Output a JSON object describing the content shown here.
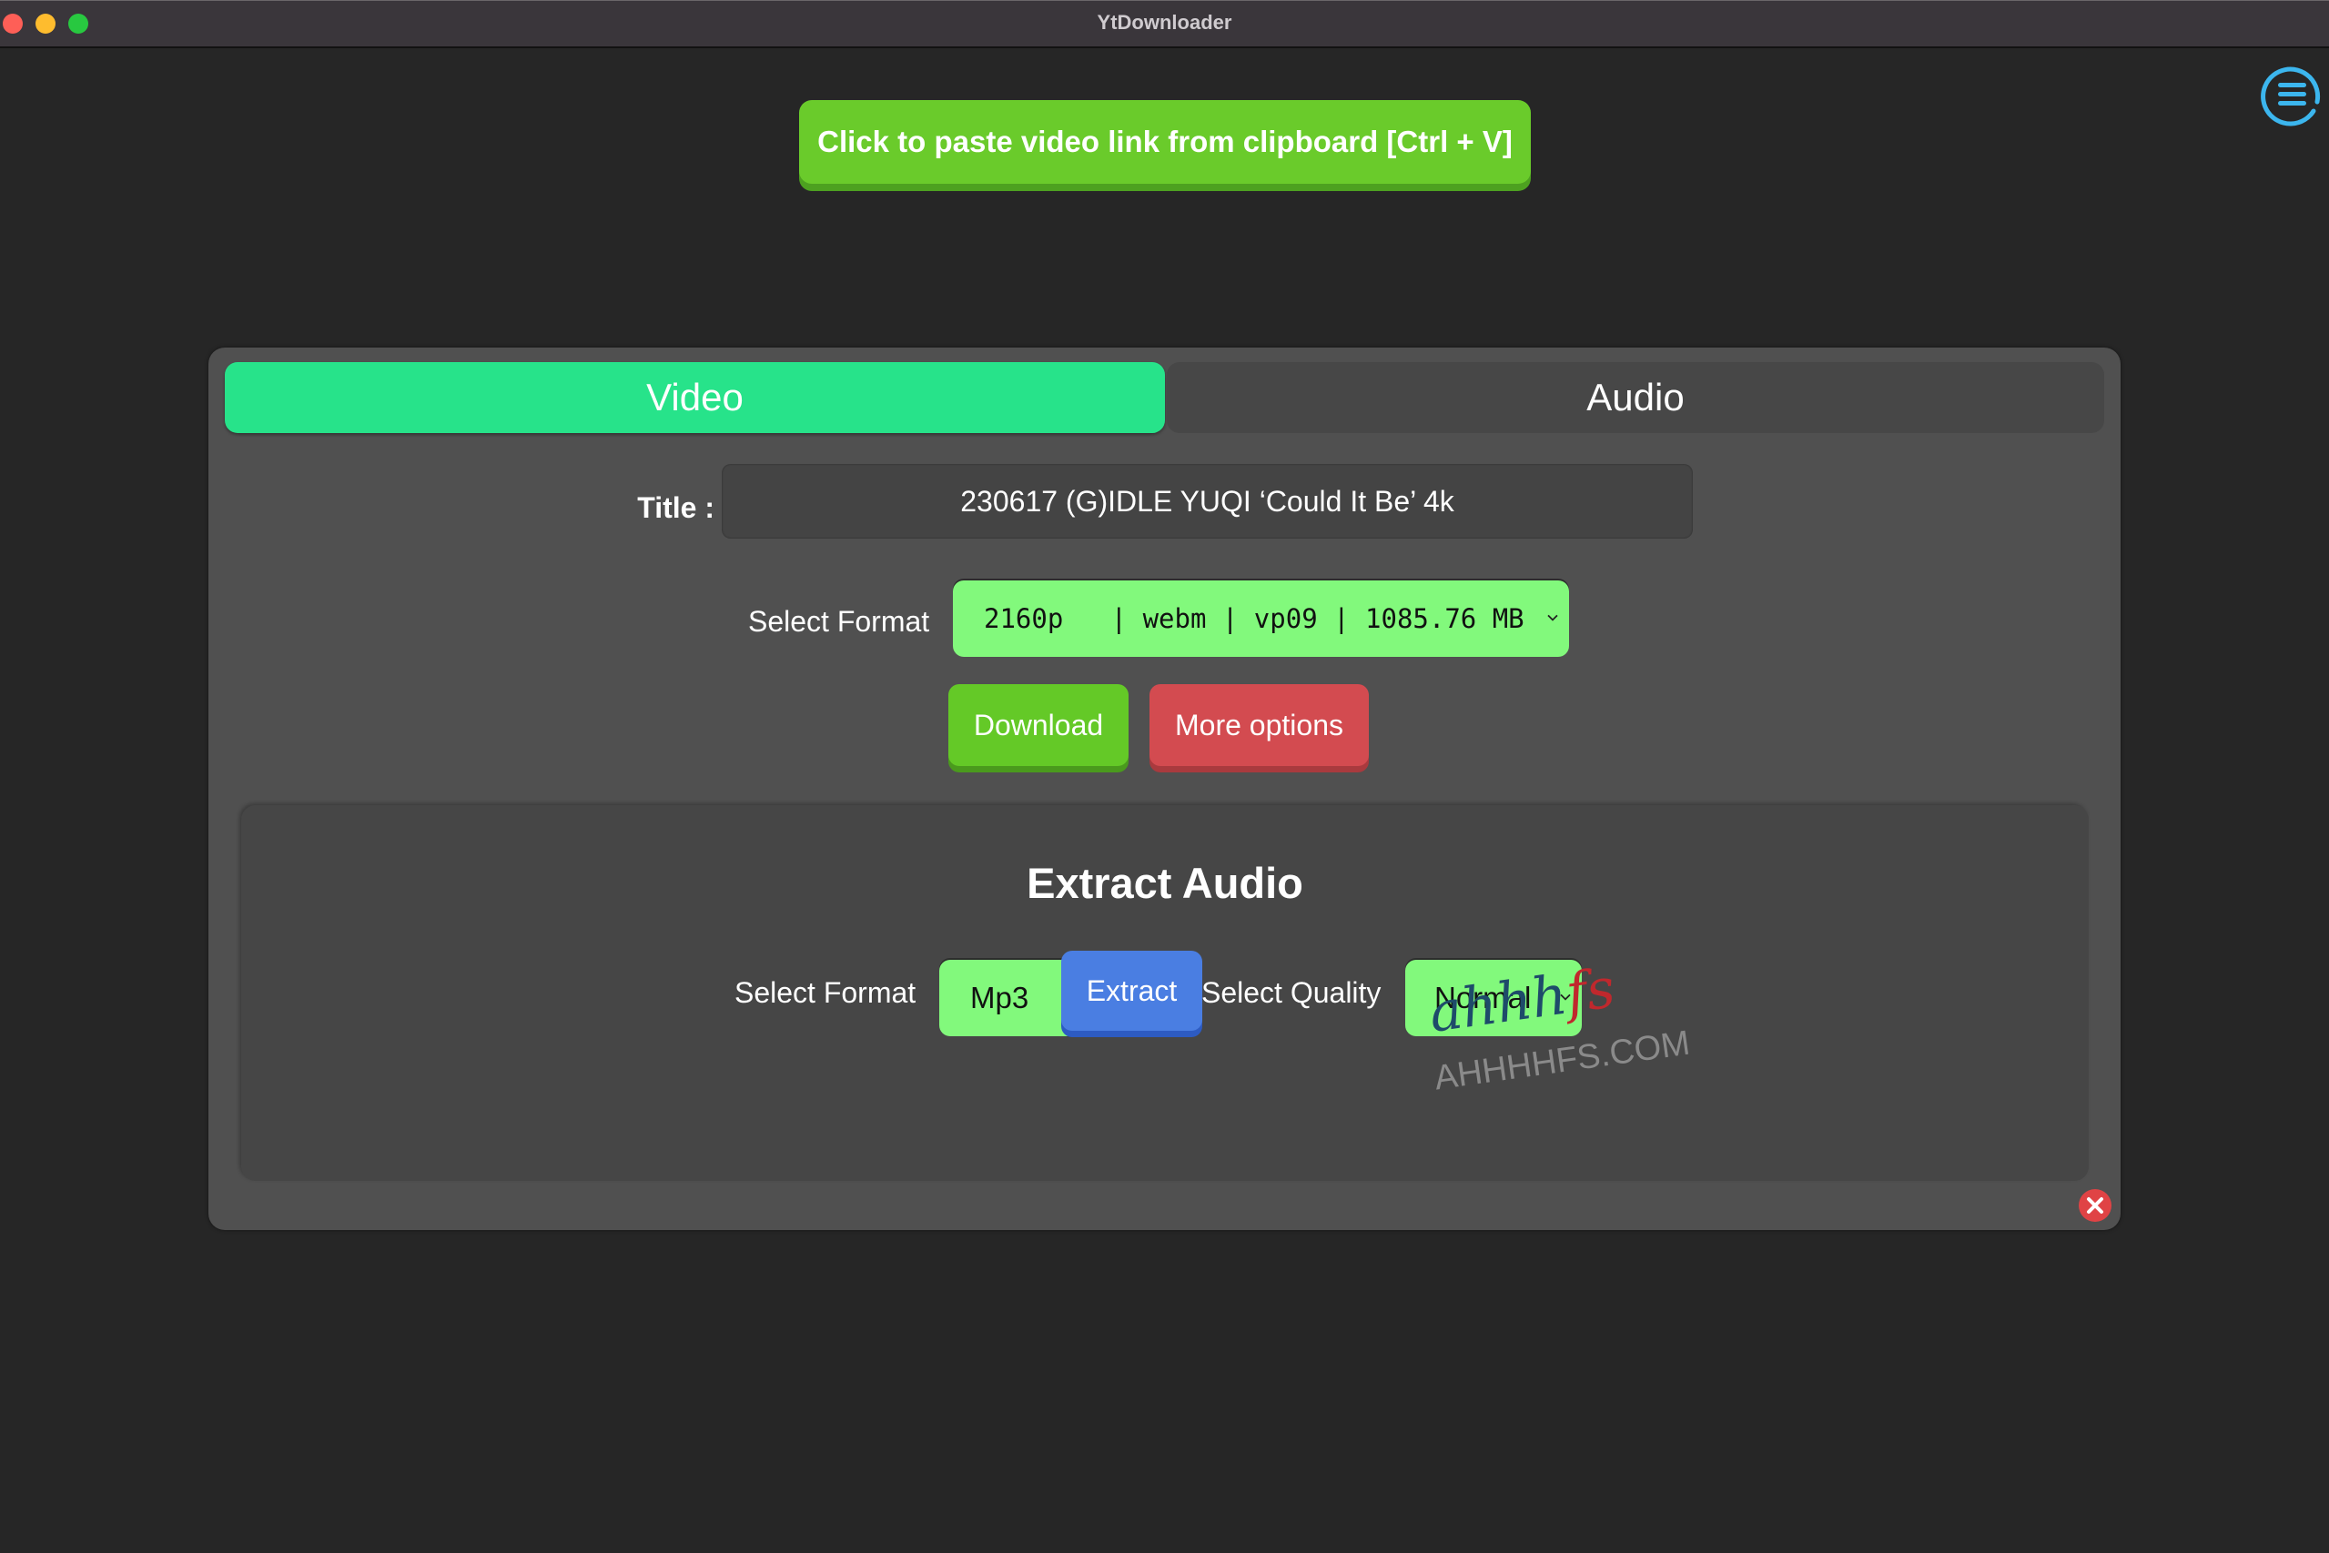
{
  "window": {
    "title": "YtDownloader",
    "traffic_lights": [
      "close",
      "minimize",
      "maximize"
    ]
  },
  "header": {
    "paste_button_label": "Click to paste video link from clipboard [Ctrl + V]",
    "menu_icon": "hamburger-menu-icon"
  },
  "tabs": [
    {
      "label": "Video",
      "active": true
    },
    {
      "label": "Audio",
      "active": false
    }
  ],
  "video": {
    "title_label": "Title :",
    "title_value": "230617 (G)IDLE YUQI ‘Could It Be’ 4k",
    "format_label": "Select Format",
    "format_selected": "2160p   | webm | vp09 | 1085.76 MB",
    "download_label": "Download",
    "more_options_label": "More options"
  },
  "extract_audio": {
    "heading": "Extract Audio",
    "format_label": "Select Format",
    "format_selected": "Mp3",
    "quality_label": "Select Quality",
    "quality_selected": "Normal",
    "extract_label": "Extract"
  },
  "watermark": {
    "script": "ahhh",
    "script_accent": "fs",
    "domain": "AHHHHFS.COM"
  },
  "colors": {
    "background": "#262626",
    "panel": "#505050",
    "section": "#464646",
    "paste_green": "#6acb2b",
    "tab_active": "#27e38a",
    "select_green": "#82f97c",
    "download_green": "#64c927",
    "more_options_red": "#d34b50",
    "extract_blue": "#4a7ee2",
    "close_red": "#e04345",
    "menu_icon_blue": "#3cb6ee"
  }
}
